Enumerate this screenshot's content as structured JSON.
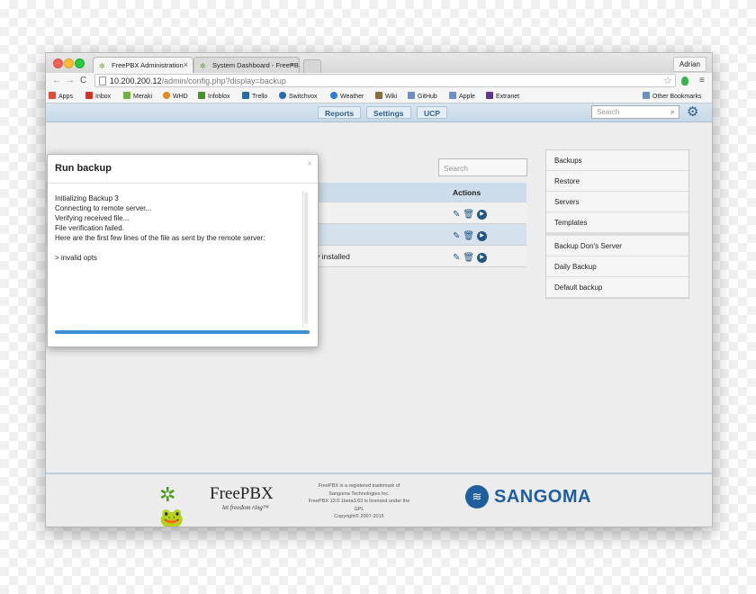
{
  "browser": {
    "tabs": [
      {
        "label": "FreePBX Administration",
        "active": true
      },
      {
        "label": "System Dashboard - FreePBX",
        "active": false
      }
    ],
    "user": "Adrian",
    "url_host": "10.200.200.12",
    "url_path": "/admin/config.php?display=backup",
    "bookmarks": [
      {
        "label": "Apps",
        "color": "#e34b3c"
      },
      {
        "label": "Inbox",
        "color": "#d93025"
      },
      {
        "label": "Meraki",
        "color": "#6cb33f"
      },
      {
        "label": "WHD",
        "color": "#e8881c"
      },
      {
        "label": "Infoblox",
        "color": "#4b8f2b"
      },
      {
        "label": "Trello",
        "color": "#1f6fb0"
      },
      {
        "label": "Switchvox",
        "color": "#2a6ab3"
      },
      {
        "label": "Weather",
        "color": "#2c7bd6"
      },
      {
        "label": "Wiki",
        "color": "#8a6d3b"
      },
      {
        "label": "GitHub",
        "color": "#6b8fc2"
      },
      {
        "label": "Apple",
        "color": "#6b8fc2"
      },
      {
        "label": "Extranet",
        "color": "#5b3a8e"
      }
    ],
    "other_bookmarks": "Other Bookmarks"
  },
  "topnav": {
    "items": [
      "Reports",
      "Settings",
      "UCP"
    ],
    "search_placeholder": "Search"
  },
  "main": {
    "table_search_placeholder": "Search",
    "actions_header": "Actions",
    "rows": [
      {
        "text": ""
      },
      {
        "text": ""
      },
      {
        "text": "y installed"
      }
    ]
  },
  "sidebar": {
    "group1": [
      "Backups",
      "Restore",
      "Servers",
      "Templates"
    ],
    "group2": [
      "Backup Don's Server",
      "Daily Backup",
      "Default backup"
    ]
  },
  "modal": {
    "title": "Run backup",
    "close": "×",
    "log": [
      "Initializing Backup 3",
      "Connecting to remote server...",
      "Verifying received file...",
      "File verification failed.",
      "Here are the first few lines of the file as sent by the remote server:",
      "",
      "> invalid opts"
    ],
    "progress": 1.0
  },
  "footer": {
    "freepbx_name": "FreePBX",
    "freepbx_tagline": "let freedom ring™",
    "legal": [
      "FreePBX is a registered trademark of",
      "Sangoma Technologies Inc.",
      "FreePBX 13.0.1beta3.63 is licensed under the GPL",
      "Copyright© 2007-2015"
    ],
    "sangoma_name": "SANGOMA"
  }
}
